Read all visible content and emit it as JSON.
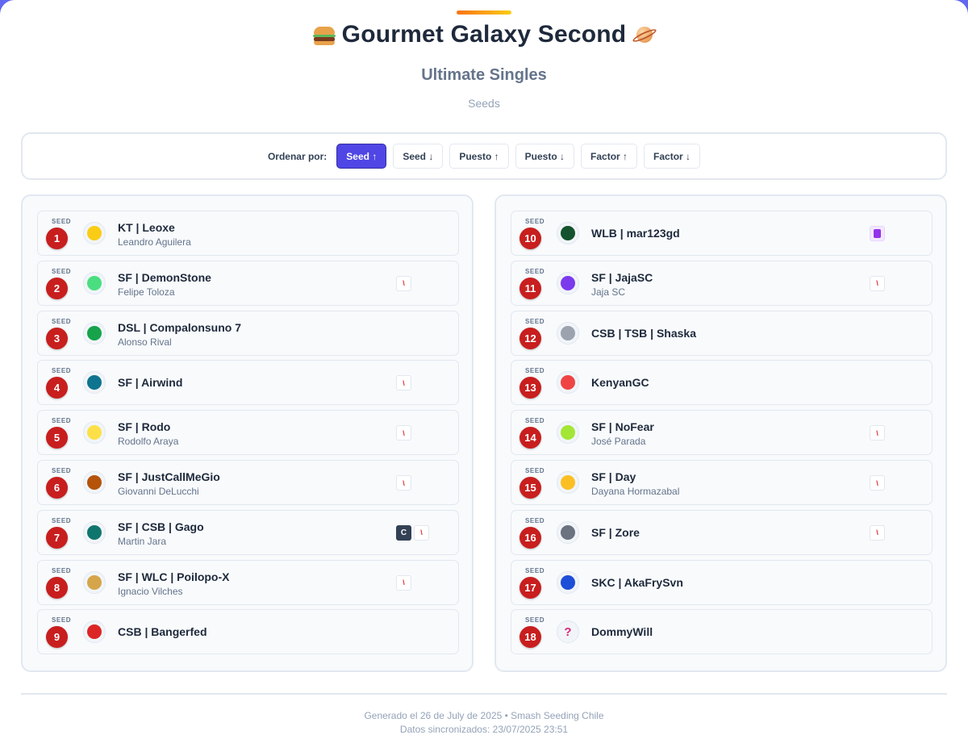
{
  "header": {
    "title": "Gourmet Galaxy Second",
    "title_left_icon": "burger-icon",
    "title_right_icon": "ringed-planet-icon",
    "subtitle": "Ultimate Singles",
    "section": "Seeds"
  },
  "sort": {
    "label": "Ordenar por:",
    "buttons": [
      {
        "label": "Seed ↑",
        "active": true
      },
      {
        "label": "Seed ↓",
        "active": false
      },
      {
        "label": "Puesto ↑",
        "active": false
      },
      {
        "label": "Puesto ↓",
        "active": false
      },
      {
        "label": "Factor ↑",
        "active": false
      },
      {
        "label": "Factor ↓",
        "active": false
      }
    ]
  },
  "seed_word": "SEED",
  "colors": {
    "accent": "#4f46e5",
    "seed_badge": "#c81e1e",
    "card_border": "#e2e8f0"
  },
  "players": [
    {
      "seed": "1",
      "tag": "KT | Leoxe",
      "name": "Leandro Aguilera",
      "character_icon": "yellow-character-icon",
      "avatar_color": "#facc15",
      "badges": []
    },
    {
      "seed": "2",
      "tag": "SF | DemonStone",
      "name": "Felipe Toloza",
      "character_icon": "green-dino-character-icon",
      "avatar_color": "#4ade80",
      "badges": [
        {
          "text": "\\",
          "style": "red"
        }
      ]
    },
    {
      "seed": "3",
      "tag": "DSL | Compalonsuno 7",
      "name": "Alonso Rival",
      "character_icon": "green-plant-character-icon",
      "avatar_color": "#16a34a",
      "badges": []
    },
    {
      "seed": "4",
      "tag": "SF | Airwind",
      "name": "",
      "character_icon": "blue-bird-character-icon",
      "avatar_color": "#0e7490",
      "badges": [
        {
          "text": "\\",
          "style": "red"
        }
      ]
    },
    {
      "seed": "5",
      "tag": "SF | Rodo",
      "name": "Rodolfo Araya",
      "character_icon": "yellow-round-character-icon",
      "avatar_color": "#fde047",
      "badges": [
        {
          "text": "\\",
          "style": "red"
        }
      ]
    },
    {
      "seed": "6",
      "tag": "SF | JustCallMeGio",
      "name": "Giovanni DeLucchi",
      "character_icon": "brown-beast-character-icon",
      "avatar_color": "#b45309",
      "badges": [
        {
          "text": "\\",
          "style": "red"
        }
      ]
    },
    {
      "seed": "7",
      "tag": "SF | CSB | Gago",
      "name": "Martin Jara",
      "character_icon": "teal-shell-character-icon",
      "avatar_color": "#0f766e",
      "badges": [
        {
          "text": "C",
          "style": "dark"
        },
        {
          "text": "\\",
          "style": "red"
        }
      ]
    },
    {
      "seed": "8",
      "tag": "SF | WLC | Poilopo-X",
      "name": "Ignacio Vilches",
      "character_icon": "spiky-blond-character-icon",
      "avatar_color": "#d6a54a",
      "badges": [
        {
          "text": "\\",
          "style": "red"
        }
      ]
    },
    {
      "seed": "9",
      "tag": "CSB | Bangerfed",
      "name": "",
      "character_icon": "red-cap-character-icon",
      "avatar_color": "#dc2626",
      "badges": []
    },
    {
      "seed": "10",
      "tag": "WLB | mar123gd",
      "name": "",
      "character_icon": "green-block-character-icon",
      "avatar_color": "#14532d",
      "badges": [
        {
          "text": "",
          "style": "purple"
        }
      ]
    },
    {
      "seed": "11",
      "tag": "SF | JajaSC",
      "name": "Jaja SC",
      "character_icon": "purple-hat-character-icon",
      "avatar_color": "#7c3aed",
      "badges": [
        {
          "text": "\\",
          "style": "red"
        }
      ]
    },
    {
      "seed": "12",
      "tag": "CSB | TSB | Shaska",
      "name": "",
      "character_icon": "grey-hood-character-icon",
      "avatar_color": "#9ca3af",
      "badges": []
    },
    {
      "seed": "13",
      "tag": "KenyanGC",
      "name": "",
      "character_icon": "red-cap-character-icon",
      "avatar_color": "#ef4444",
      "badges": []
    },
    {
      "seed": "14",
      "tag": "SF | NoFear",
      "name": "José Parada",
      "character_icon": "lime-character-icon",
      "avatar_color": "#a3e635",
      "badges": [
        {
          "text": "\\",
          "style": "red"
        }
      ]
    },
    {
      "seed": "15",
      "tag": "SF | Day",
      "name": "Dayana Hormazabal",
      "character_icon": "yellow-bird-character-icon",
      "avatar_color": "#fbbf24",
      "badges": [
        {
          "text": "\\",
          "style": "red"
        }
      ]
    },
    {
      "seed": "16",
      "tag": "SF | Zore",
      "name": "",
      "character_icon": "robot-character-icon",
      "avatar_color": "#6b7280",
      "badges": [
        {
          "text": "\\",
          "style": "red"
        }
      ]
    },
    {
      "seed": "17",
      "tag": "SKC | AkaFrySvn",
      "name": "",
      "character_icon": "blue-hedgehog-character-icon",
      "avatar_color": "#1d4ed8",
      "badges": []
    },
    {
      "seed": "18",
      "tag": "DommyWill",
      "name": "",
      "character_icon": "question-mark-icon",
      "avatar_color": "",
      "badges": []
    }
  ],
  "footer": {
    "generated": "Generado el 26 de July de 2025 • Smash Seeding Chile",
    "synced": "Datos sincronizados: 23/07/2025 23:51"
  }
}
